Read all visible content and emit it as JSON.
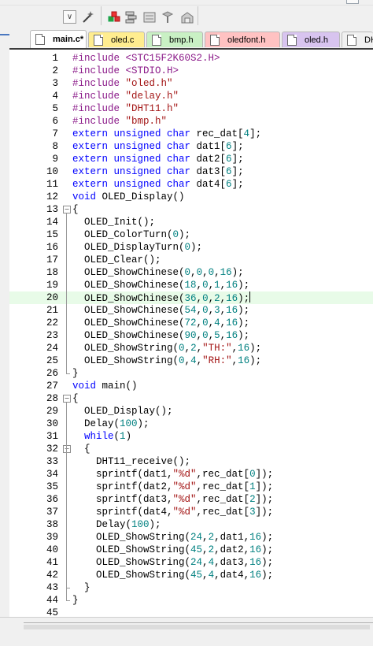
{
  "toolbar": {
    "dropdown_glyph": "∨",
    "buttons": [
      {
        "name": "wand-icon"
      },
      {
        "name": "manage-components-icon"
      },
      {
        "name": "batch-build-icon"
      },
      {
        "name": "debug-icon"
      },
      {
        "name": "pin-icon"
      }
    ]
  },
  "tabs": [
    {
      "label": "main.c*",
      "color": "#ffffff",
      "active": true
    },
    {
      "label": "oled.c",
      "color": "#ffed8f",
      "active": false
    },
    {
      "label": "bmp.h",
      "color": "#c9f0c4",
      "active": false
    },
    {
      "label": "oledfont.h",
      "color": "#ffc2c2",
      "active": false
    },
    {
      "label": "oled.h",
      "color": "#d8c4ef",
      "active": false
    },
    {
      "label": "DH",
      "color": "#f0f0f0",
      "active": false
    }
  ],
  "editor": {
    "current_line": 20,
    "lines": [
      {
        "n": "1",
        "t": [
          [
            "pp",
            "#include "
          ],
          [
            "hdr",
            "<STC15F2K60S2.H>"
          ]
        ]
      },
      {
        "n": "2",
        "t": [
          [
            "pp",
            "#include "
          ],
          [
            "hdr",
            "<STDIO.H>"
          ]
        ]
      },
      {
        "n": "3",
        "t": [
          [
            "pp",
            "#include "
          ],
          [
            "str",
            "\"oled.h\""
          ]
        ]
      },
      {
        "n": "4",
        "t": [
          [
            "pp",
            "#include "
          ],
          [
            "str",
            "\"delay.h\""
          ]
        ]
      },
      {
        "n": "5",
        "t": [
          [
            "pp",
            "#include "
          ],
          [
            "str",
            "\"DHT11.h\""
          ]
        ]
      },
      {
        "n": "6",
        "t": [
          [
            "pp",
            "#include "
          ],
          [
            "str",
            "\"bmp.h\""
          ]
        ]
      },
      {
        "n": "7",
        "t": [
          [
            "kw",
            "extern unsigned char "
          ],
          [
            "",
            "rec_dat["
          ],
          [
            "num",
            "4"
          ],
          [
            "",
            "];"
          ]
        ]
      },
      {
        "n": "8",
        "t": [
          [
            "kw",
            "extern unsigned char "
          ],
          [
            "",
            "dat1["
          ],
          [
            "num",
            "6"
          ],
          [
            "",
            "];"
          ]
        ]
      },
      {
        "n": "9",
        "t": [
          [
            "kw",
            "extern unsigned char "
          ],
          [
            "",
            "dat2["
          ],
          [
            "num",
            "6"
          ],
          [
            "",
            "];"
          ]
        ]
      },
      {
        "n": "10",
        "t": [
          [
            "kw",
            "extern unsigned char "
          ],
          [
            "",
            "dat3["
          ],
          [
            "num",
            "6"
          ],
          [
            "",
            "];"
          ]
        ]
      },
      {
        "n": "11",
        "t": [
          [
            "kw",
            "extern unsigned char "
          ],
          [
            "",
            "dat4["
          ],
          [
            "num",
            "6"
          ],
          [
            "",
            "];"
          ]
        ]
      },
      {
        "n": "12",
        "t": [
          [
            "kw",
            "void "
          ],
          [
            "",
            "OLED_Display()"
          ]
        ]
      },
      {
        "n": "13",
        "fold": "open",
        "t": [
          [
            "",
            "{"
          ]
        ]
      },
      {
        "n": "14",
        "t": [
          [
            "",
            "  OLED_Init();"
          ]
        ]
      },
      {
        "n": "15",
        "t": [
          [
            "",
            "  OLED_ColorTurn("
          ],
          [
            "num",
            "0"
          ],
          [
            "",
            ");"
          ]
        ]
      },
      {
        "n": "16",
        "t": [
          [
            "",
            "  OLED_DisplayTurn("
          ],
          [
            "num",
            "0"
          ],
          [
            "",
            ");"
          ]
        ]
      },
      {
        "n": "17",
        "t": [
          [
            "",
            "  OLED_Clear();"
          ]
        ]
      },
      {
        "n": "18",
        "t": [
          [
            "",
            "  OLED_ShowChinese("
          ],
          [
            "num",
            "0"
          ],
          [
            "",
            ","
          ],
          [
            "num",
            "0"
          ],
          [
            "",
            ","
          ],
          [
            "num",
            "0"
          ],
          [
            "",
            ","
          ],
          [
            "num",
            "16"
          ],
          [
            "",
            ");"
          ]
        ]
      },
      {
        "n": "19",
        "t": [
          [
            "",
            "  OLED_ShowChinese("
          ],
          [
            "num",
            "18"
          ],
          [
            "",
            ","
          ],
          [
            "num",
            "0"
          ],
          [
            "",
            ","
          ],
          [
            "num",
            "1"
          ],
          [
            "",
            ","
          ],
          [
            "num",
            "16"
          ],
          [
            "",
            ");"
          ]
        ]
      },
      {
        "n": "20",
        "caret": true,
        "t": [
          [
            "",
            "  OLED_ShowChinese("
          ],
          [
            "num",
            "36"
          ],
          [
            "",
            ","
          ],
          [
            "num",
            "0"
          ],
          [
            "",
            ","
          ],
          [
            "num",
            "2"
          ],
          [
            "",
            ","
          ],
          [
            "num",
            "16"
          ],
          [
            "",
            ");"
          ]
        ]
      },
      {
        "n": "21",
        "t": [
          [
            "",
            "  OLED_ShowChinese("
          ],
          [
            "num",
            "54"
          ],
          [
            "",
            ","
          ],
          [
            "num",
            "0"
          ],
          [
            "",
            ","
          ],
          [
            "num",
            "3"
          ],
          [
            "",
            ","
          ],
          [
            "num",
            "16"
          ],
          [
            "",
            ");"
          ]
        ]
      },
      {
        "n": "22",
        "t": [
          [
            "",
            "  OLED_ShowChinese("
          ],
          [
            "num",
            "72"
          ],
          [
            "",
            ","
          ],
          [
            "num",
            "0"
          ],
          [
            "",
            ","
          ],
          [
            "num",
            "4"
          ],
          [
            "",
            ","
          ],
          [
            "num",
            "16"
          ],
          [
            "",
            ");"
          ]
        ]
      },
      {
        "n": "23",
        "t": [
          [
            "",
            "  OLED_ShowChinese("
          ],
          [
            "num",
            "90"
          ],
          [
            "",
            ","
          ],
          [
            "num",
            "0"
          ],
          [
            "",
            ","
          ],
          [
            "num",
            "5"
          ],
          [
            "",
            ","
          ],
          [
            "num",
            "16"
          ],
          [
            "",
            ");"
          ]
        ]
      },
      {
        "n": "24",
        "t": [
          [
            "",
            "  OLED_ShowString("
          ],
          [
            "num",
            "0"
          ],
          [
            "",
            ","
          ],
          [
            "num",
            "2"
          ],
          [
            "",
            ","
          ],
          [
            "str",
            "\"TH:\""
          ],
          [
            "",
            ","
          ],
          [
            "num",
            "16"
          ],
          [
            "",
            ");"
          ]
        ]
      },
      {
        "n": "25",
        "t": [
          [
            "",
            "  OLED_ShowString("
          ],
          [
            "num",
            "0"
          ],
          [
            "",
            ","
          ],
          [
            "num",
            "4"
          ],
          [
            "",
            ","
          ],
          [
            "str",
            "\"RH:\""
          ],
          [
            "",
            ","
          ],
          [
            "num",
            "16"
          ],
          [
            "",
            ");"
          ]
        ]
      },
      {
        "n": "26",
        "fold": "end",
        "t": [
          [
            "",
            "}"
          ]
        ]
      },
      {
        "n": "27",
        "t": [
          [
            "kw",
            "void "
          ],
          [
            "",
            "main()"
          ]
        ]
      },
      {
        "n": "28",
        "fold": "open",
        "t": [
          [
            "",
            "{"
          ]
        ]
      },
      {
        "n": "29",
        "t": [
          [
            "",
            "  OLED_Display();"
          ]
        ]
      },
      {
        "n": "30",
        "t": [
          [
            "",
            "  Delay("
          ],
          [
            "num",
            "100"
          ],
          [
            "",
            ");"
          ]
        ]
      },
      {
        "n": "31",
        "t": [
          [
            "",
            "  "
          ],
          [
            "kw",
            "while"
          ],
          [
            "",
            "("
          ],
          [
            "num",
            "1"
          ],
          [
            "",
            ")"
          ]
        ]
      },
      {
        "n": "32",
        "fold": "open2",
        "t": [
          [
            "",
            "  {"
          ]
        ]
      },
      {
        "n": "33",
        "t": [
          [
            "",
            "    DHT11_receive();"
          ]
        ]
      },
      {
        "n": "34",
        "t": [
          [
            "",
            "    sprintf(dat1,"
          ],
          [
            "str",
            "\"%d\""
          ],
          [
            "",
            ",rec_dat["
          ],
          [
            "num",
            "0"
          ],
          [
            "",
            "]);"
          ]
        ]
      },
      {
        "n": "35",
        "t": [
          [
            "",
            "    sprintf(dat2,"
          ],
          [
            "str",
            "\"%d\""
          ],
          [
            "",
            ",rec_dat["
          ],
          [
            "num",
            "1"
          ],
          [
            "",
            "]);"
          ]
        ]
      },
      {
        "n": "36",
        "t": [
          [
            "",
            "    sprintf(dat3,"
          ],
          [
            "str",
            "\"%d\""
          ],
          [
            "",
            ",rec_dat["
          ],
          [
            "num",
            "2"
          ],
          [
            "",
            "]);"
          ]
        ]
      },
      {
        "n": "37",
        "t": [
          [
            "",
            "    sprintf(dat4,"
          ],
          [
            "str",
            "\"%d\""
          ],
          [
            "",
            ",rec_dat["
          ],
          [
            "num",
            "3"
          ],
          [
            "",
            "]);"
          ]
        ]
      },
      {
        "n": "38",
        "t": [
          [
            "",
            "    Delay("
          ],
          [
            "num",
            "100"
          ],
          [
            "",
            ");"
          ]
        ]
      },
      {
        "n": "39",
        "t": [
          [
            "",
            "    OLED_ShowString("
          ],
          [
            "num",
            "24"
          ],
          [
            "",
            ","
          ],
          [
            "num",
            "2"
          ],
          [
            "",
            ",dat1,"
          ],
          [
            "num",
            "16"
          ],
          [
            "",
            ");"
          ]
        ]
      },
      {
        "n": "40",
        "t": [
          [
            "",
            "    OLED_ShowString("
          ],
          [
            "num",
            "45"
          ],
          [
            "",
            ","
          ],
          [
            "num",
            "2"
          ],
          [
            "",
            ",dat2,"
          ],
          [
            "num",
            "16"
          ],
          [
            "",
            ");"
          ]
        ]
      },
      {
        "n": "41",
        "t": [
          [
            "",
            "    OLED_ShowString("
          ],
          [
            "num",
            "24"
          ],
          [
            "",
            ","
          ],
          [
            "num",
            "4"
          ],
          [
            "",
            ",dat3,"
          ],
          [
            "num",
            "16"
          ],
          [
            "",
            ");"
          ]
        ]
      },
      {
        "n": "42",
        "t": [
          [
            "",
            "    OLED_ShowString("
          ],
          [
            "num",
            "45"
          ],
          [
            "",
            ","
          ],
          [
            "num",
            "4"
          ],
          [
            "",
            ",dat4,"
          ],
          [
            "num",
            "16"
          ],
          [
            "",
            ");"
          ]
        ]
      },
      {
        "n": "43",
        "fold": "end2",
        "t": [
          [
            "",
            "  }"
          ]
        ]
      },
      {
        "n": "44",
        "fold": "end",
        "t": [
          [
            "",
            "}"
          ]
        ]
      },
      {
        "n": "45",
        "t": []
      }
    ]
  }
}
